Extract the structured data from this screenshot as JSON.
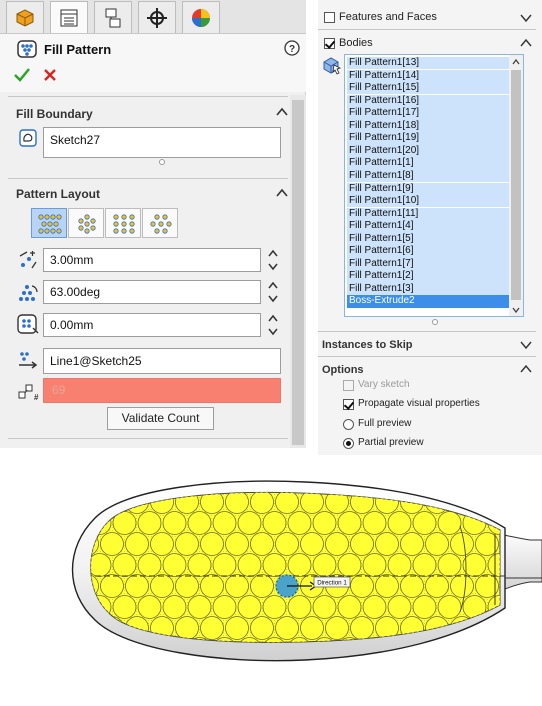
{
  "property_manager": {
    "title": "Fill Pattern",
    "tabs": [
      "feature-manager-icon",
      "property-manager-icon",
      "configuration-manager-icon",
      "dimxpert-icon",
      "appearance-icon"
    ],
    "fill_boundary": {
      "header": "Fill Boundary",
      "value": "Sketch27"
    },
    "pattern_layout": {
      "header": "Pattern Layout",
      "layout_types": [
        "perforation",
        "circular",
        "square",
        "polygon"
      ],
      "instance_spacing": "3.00mm",
      "stagger_angle": "63.00deg",
      "margins": "0.00mm",
      "direction": "Line1@Sketch25",
      "instance_count": "69",
      "validate_button": "Validate Count"
    }
  },
  "right_panel": {
    "features_and_faces": {
      "label": "Features and Faces",
      "checked": false
    },
    "bodies": {
      "label": "Bodies",
      "checked": true,
      "items": [
        "Fill Pattern1[13]",
        "Fill Pattern1[14]",
        "Fill Pattern1[15]",
        "Fill Pattern1[16]",
        "Fill Pattern1[17]",
        "Fill Pattern1[18]",
        "Fill Pattern1[19]",
        "Fill Pattern1[20]",
        "Fill Pattern1[1]",
        "Fill Pattern1[8]",
        "Fill Pattern1[9]",
        "Fill Pattern1[10]",
        "Fill Pattern1[11]",
        "Fill Pattern1[4]",
        "Fill Pattern1[5]",
        "Fill Pattern1[6]",
        "Fill Pattern1[7]",
        "Fill Pattern1[2]",
        "Fill Pattern1[3]",
        "Boss-Extrude2"
      ],
      "selected_item": "Boss-Extrude2"
    },
    "instances_to_skip": {
      "label": "Instances to Skip"
    },
    "options": {
      "label": "Options",
      "vary_sketch": {
        "label": "Vary sketch",
        "checked": false,
        "enabled": false
      },
      "propagate_visual": {
        "label": "Propagate visual properties",
        "checked": true
      },
      "full_preview": {
        "label": "Full preview",
        "selected": false
      },
      "partial_preview": {
        "label": "Partial preview",
        "selected": true
      }
    }
  },
  "viewport": {
    "direction_callout": "Direction 1",
    "colors": {
      "hole_fill": "#ffff33",
      "seed": "#4aa3c8",
      "error_field": "#f88070",
      "selection": "#3d8ee8"
    }
  }
}
